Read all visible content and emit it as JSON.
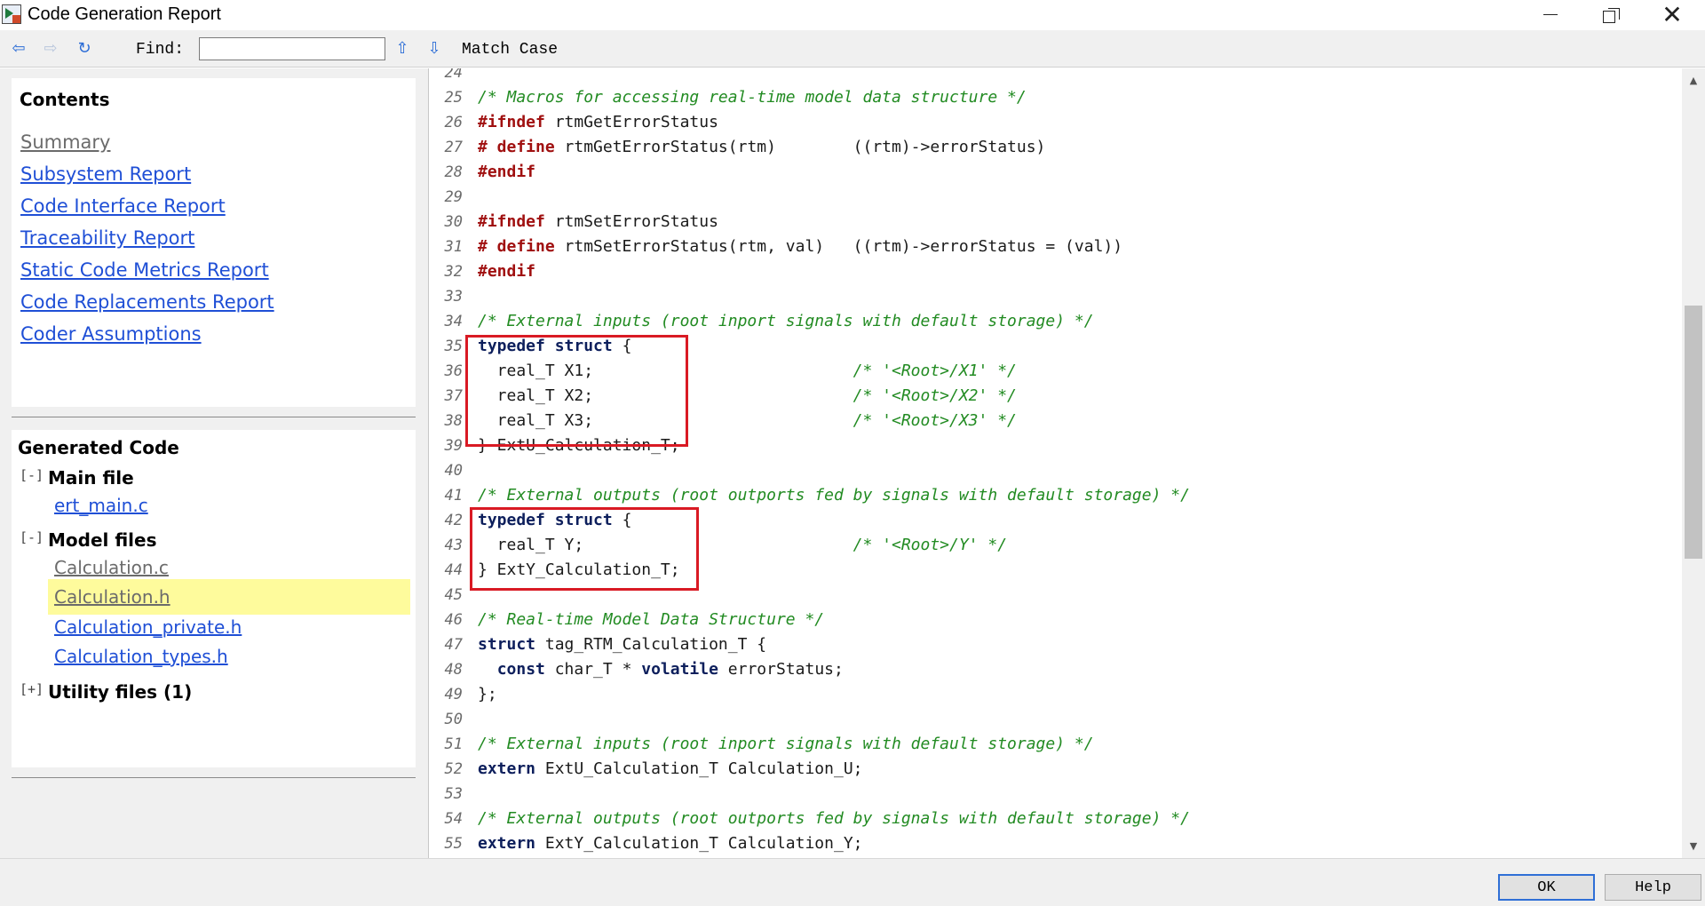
{
  "window": {
    "title": "Code Generation Report",
    "close_glyph": "✕"
  },
  "toolbar": {
    "back_glyph": "⇦",
    "forward_glyph": "⇨",
    "refresh_glyph": "↻",
    "find_label": "Find:",
    "find_value": "",
    "up_glyph": "⇧",
    "down_glyph": "⇩",
    "match_case_label": "Match Case"
  },
  "contents": {
    "heading": "Contents",
    "links": [
      "Summary",
      "Subsystem Report",
      "Code Interface Report",
      "Traceability Report",
      "Static Code Metrics Report",
      "Code Replacements Report",
      "Coder Assumptions"
    ]
  },
  "generated_code": {
    "heading": "Generated Code",
    "main_file": {
      "toggle": "[-]",
      "label": "Main file",
      "files": [
        "ert_main.c"
      ]
    },
    "model_files": {
      "toggle": "[-]",
      "label": "Model files",
      "files": [
        "Calculation.c",
        "Calculation.h",
        "Calculation_private.h",
        "Calculation_types.h"
      ],
      "selected": "Calculation.h"
    },
    "utility_files": {
      "toggle": "[+]",
      "label": "Utility files (1)"
    }
  },
  "code_lines": [
    {
      "n": "24",
      "t": ""
    },
    {
      "n": "25",
      "t": "/* Macros for accessing real-time model data structure */"
    },
    {
      "n": "26",
      "t": "#ifndef rtmGetErrorStatus"
    },
    {
      "n": "27",
      "t": "# define rtmGetErrorStatus(rtm)        ((rtm)->errorStatus)"
    },
    {
      "n": "28",
      "t": "#endif"
    },
    {
      "n": "29",
      "t": ""
    },
    {
      "n": "30",
      "t": "#ifndef rtmSetErrorStatus"
    },
    {
      "n": "31",
      "t": "# define rtmSetErrorStatus(rtm, val)   ((rtm)->errorStatus = (val))"
    },
    {
      "n": "32",
      "t": "#endif"
    },
    {
      "n": "33",
      "t": ""
    },
    {
      "n": "34",
      "t": "/* External inputs (root inport signals with default storage) */"
    },
    {
      "n": "35",
      "t": "typedef struct {"
    },
    {
      "n": "36",
      "t": "  real_T X1;                           /* '<Root>/X1' */"
    },
    {
      "n": "37",
      "t": "  real_T X2;                           /* '<Root>/X2' */"
    },
    {
      "n": "38",
      "t": "  real_T X3;                           /* '<Root>/X3' */"
    },
    {
      "n": "39",
      "t": "} ExtU_Calculation_T;"
    },
    {
      "n": "40",
      "t": ""
    },
    {
      "n": "41",
      "t": "/* External outputs (root outports fed by signals with default storage) */"
    },
    {
      "n": "42",
      "t": "typedef struct {"
    },
    {
      "n": "43",
      "t": "  real_T Y;                            /* '<Root>/Y' */"
    },
    {
      "n": "44",
      "t": "} ExtY_Calculation_T;"
    },
    {
      "n": "45",
      "t": ""
    },
    {
      "n": "46",
      "t": "/* Real-time Model Data Structure */"
    },
    {
      "n": "47",
      "t": "struct tag_RTM_Calculation_T {"
    },
    {
      "n": "48",
      "t": "  const char_T * volatile errorStatus;"
    },
    {
      "n": "49",
      "t": "};"
    },
    {
      "n": "50",
      "t": ""
    },
    {
      "n": "51",
      "t": "/* External inputs (root inport signals with default storage) */"
    },
    {
      "n": "52",
      "t": "extern ExtU_Calculation_T Calculation_U;"
    },
    {
      "n": "53",
      "t": ""
    },
    {
      "n": "54",
      "t": "/* External outputs (root outports fed by signals with default storage) */"
    },
    {
      "n": "55",
      "t": "extern ExtY_Calculation_T Calculation_Y;"
    }
  ],
  "scroll": {
    "up_glyph": "▲",
    "down_glyph": "▼",
    "position_fraction": 0.27
  },
  "buttons": {
    "ok": "OK",
    "help": "Help"
  },
  "colors": {
    "link": "#1f4fd6",
    "comment": "#228b22",
    "preprocessor": "#a01010",
    "keyword": "#0d1f5c",
    "highlight": "#fefb9c",
    "annotation_box": "#d91a24"
  }
}
